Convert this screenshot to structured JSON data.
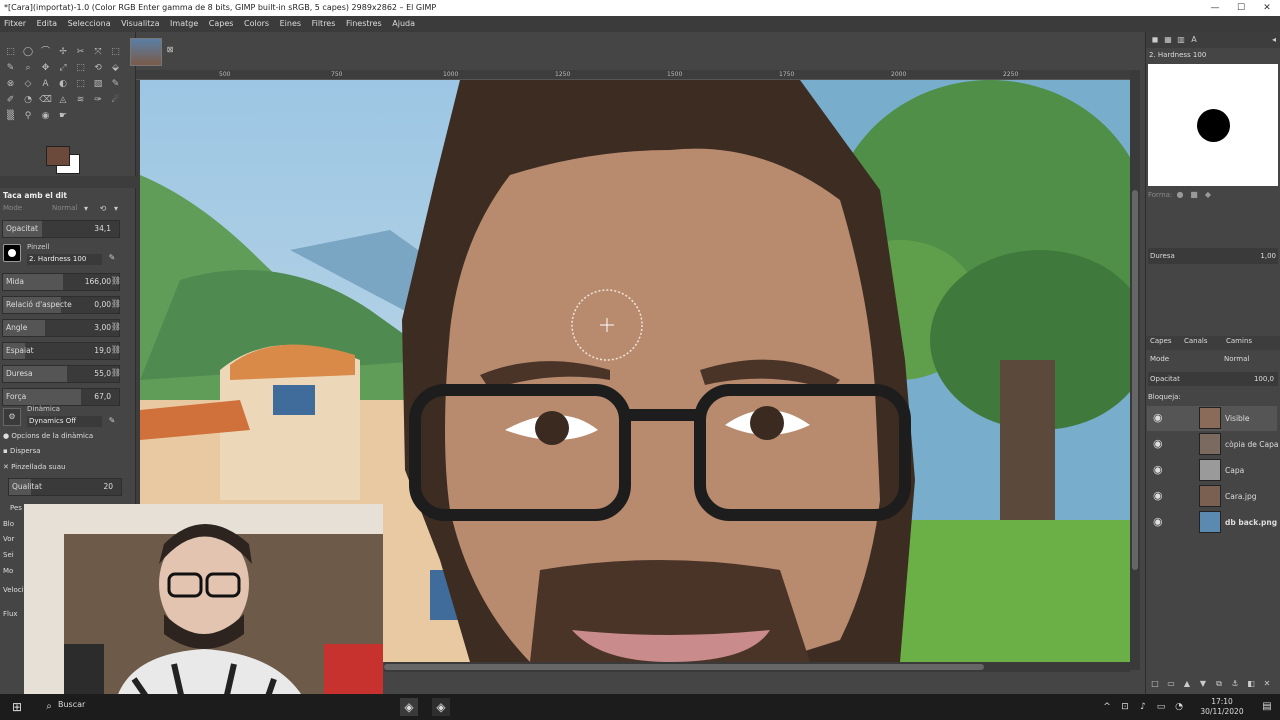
{
  "window": {
    "title": "*[Cara](importat)-1.0 (Color RGB Enter gamma de 8 bits, GIMP built-in sRGB, 5 capes) 2989x2862 – El GIMP",
    "minimize": "—",
    "maximize": "☐",
    "close": "✕"
  },
  "menu": [
    "Fitxer",
    "Edita",
    "Selecciona",
    "Visualitza",
    "Imatge",
    "Capes",
    "Colors",
    "Eines",
    "Filtres",
    "Finestres",
    "Ajuda"
  ],
  "ruler": {
    "ticks": [
      "500",
      "750",
      "1000",
      "1250",
      "1500",
      "1750",
      "2000",
      "2250"
    ]
  },
  "tool_options": {
    "title": "Taca amb el dit",
    "mode_label": "Mode",
    "mode_value": "Normal",
    "opacity_label": "Opacitat",
    "opacity_value": "34,1",
    "brush_label": "Pinzell",
    "brush_name": "2. Hardness 100",
    "size_label": "Mida",
    "size_value": "166,00",
    "aspect_label": "Relació d'aspecte",
    "aspect_value": "0,00",
    "angle_label": "Angle",
    "angle_value": "3,00",
    "spacing_label": "Espaiat",
    "spacing_value": "19,0",
    "hardness_label": "Duresa",
    "hardness_value": "55,0",
    "force_label": "Força",
    "force_value": "67,0",
    "dynamics_label": "Dinàmica",
    "dynamics_value": "Dynamics Off",
    "dynamics_options": "Opcions de la dinàmica",
    "scatter": "Dispersa",
    "smooth_stroke": "Pinzellada suau",
    "quality_label": "Qualitat",
    "quality_value": "20",
    "weight_label": "Pes",
    "flow_label": "Flux",
    "vel_label": "Velocit",
    "partial_labels": [
      "Blo",
      "Vor",
      "Sei",
      "Mo"
    ]
  },
  "brush_panel": {
    "brush_name": "2. Hardness 100",
    "forma_label": "Forma:",
    "duresa_label": "Duresa",
    "duresa_value": "1,00"
  },
  "layers_panel": {
    "tabs": [
      "Capes",
      "Canals",
      "Camins"
    ],
    "mode_label": "Mode",
    "mode_value": "Normal",
    "opacity_label": "Opacitat",
    "opacity_value": "100,0",
    "lock_label": "Bloqueja:",
    "layers": [
      {
        "name": "Visible",
        "thumb_color": "#8a6a58"
      },
      {
        "name": "còpia de Capa",
        "thumb_color": "#7a6a60"
      },
      {
        "name": "Capa",
        "thumb_color": "#9a9a9a"
      },
      {
        "name": "Cara.jpg",
        "thumb_color": "#7a6050"
      },
      {
        "name": "db back.png",
        "thumb_color": "#5b8ab0"
      }
    ]
  },
  "taskbar": {
    "search_placeholder": "Buscar",
    "time": "17:10",
    "date": "30/11/2020"
  },
  "colors": {
    "foreground": "#6b4a3c",
    "background": "#ffffff"
  }
}
